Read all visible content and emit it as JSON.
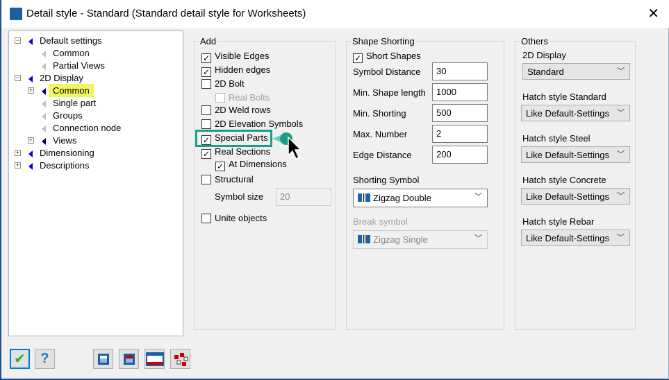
{
  "window": {
    "title": "Detail style - Standard (Standard detail style for Worksheets)"
  },
  "tree": [
    {
      "label": "Default settings",
      "level": 0,
      "expander": "minus"
    },
    {
      "label": "Common",
      "level": 1
    },
    {
      "label": "Partial Views",
      "level": 1
    },
    {
      "label": "2D Display",
      "level": 0,
      "expander": "minus"
    },
    {
      "label": "Common",
      "level": 1,
      "expander": "plus",
      "selected": true
    },
    {
      "label": "Single part",
      "level": 1
    },
    {
      "label": "Groups",
      "level": 1
    },
    {
      "label": "Connection node",
      "level": 1
    },
    {
      "label": "Views",
      "level": 1,
      "expander": "plus"
    },
    {
      "label": "Dimensioning",
      "level": 0,
      "expander": "plus"
    },
    {
      "label": "Descriptions",
      "level": 0,
      "expander": "plus"
    }
  ],
  "add": {
    "title": "Add",
    "items": [
      {
        "label": "Visible Edges",
        "checked": true
      },
      {
        "label": "Hidden edges",
        "checked": true
      },
      {
        "label": "2D Bolt",
        "checked": false
      },
      {
        "label": "Real Bolts",
        "checked": false,
        "disabled": true
      },
      {
        "label": "2D Weld rows",
        "checked": false
      },
      {
        "label": "2D Elevation Symbols",
        "checked": false
      },
      {
        "label": "Special Parts",
        "checked": true
      },
      {
        "label": "Real Sections",
        "checked": true
      },
      {
        "label": "At Dimensions",
        "checked": true
      },
      {
        "label": "Structural",
        "checked": false
      }
    ],
    "symbol_size_label": "Symbol size",
    "symbol_size_value": "20",
    "unite_objects": "Unite objects"
  },
  "shape": {
    "title": "Shape Shorting",
    "short_shapes": "Short Shapes",
    "fields": [
      {
        "label": "Symbol Distance",
        "value": "30"
      },
      {
        "label": "Min. Shape length",
        "value": "1000"
      },
      {
        "label": "Min. Shorting",
        "value": "500"
      },
      {
        "label": "Max. Number",
        "value": "2"
      },
      {
        "label": "Edge Distance",
        "value": "200"
      }
    ],
    "shorting_symbol_label": "Shorting Symbol",
    "shorting_symbol_value": "Zigzag Double",
    "break_symbol_label": "Break symbol",
    "break_symbol_value": "Zigzag Single"
  },
  "others": {
    "title": "Others",
    "items": [
      {
        "label": "2D Display",
        "value": "Standard"
      },
      {
        "label": "Hatch style Standard",
        "value": "Like Default-Settings"
      },
      {
        "label": "Hatch style Steel",
        "value": "Like Default-Settings"
      },
      {
        "label": "Hatch style Concrete",
        "value": "Like Default-Settings"
      },
      {
        "label": "Hatch style Rebar",
        "value": "Like Default-Settings"
      }
    ]
  },
  "colors": {
    "highlight": "#1a9e8a",
    "selection": "#f0f75a",
    "accent": "#1d5fa6"
  }
}
